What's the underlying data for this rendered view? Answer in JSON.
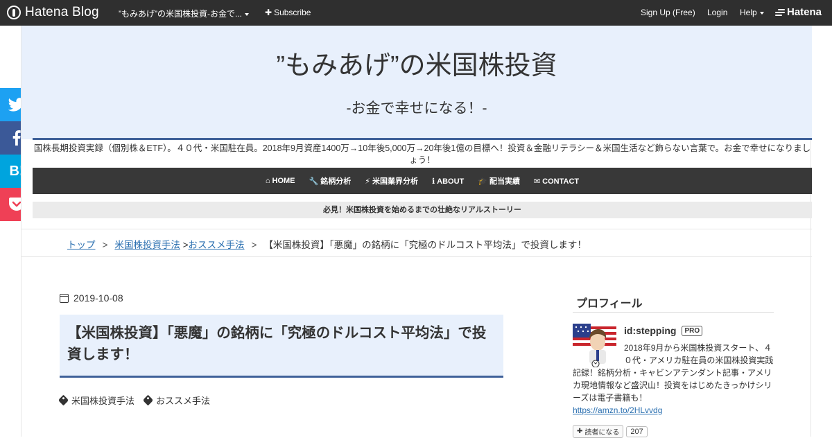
{
  "topbar": {
    "logo_text": "Hatena Blog",
    "blog_name": "”もみあげ”の米国株投資-お金で...",
    "subscribe": "Subscribe",
    "signup": "Sign Up (Free)",
    "login": "Login",
    "help": "Help",
    "hatena": "Hatena"
  },
  "header": {
    "title": "”もみあげ”の米国株投資",
    "subtitle": "-お金で幸せになる！-",
    "description": "国株長期投資実録（個別株＆ETF）。４０代・米国駐在員。2018年9月資産1400万→10年後5,000万→20年後1億の目標へ！投資＆金融リテラシー＆米国生活など飾らない言葉で。お金で幸せになりましょう！"
  },
  "nav": {
    "items": [
      {
        "icon": "home-icon",
        "glyph": "⌂",
        "label": "HOME"
      },
      {
        "icon": "wrench-icon",
        "glyph": "🔧",
        "label": "銘柄分析"
      },
      {
        "icon": "bolt-icon",
        "glyph": "⚡",
        "label": "米国業界分析"
      },
      {
        "icon": "info-icon",
        "glyph": "ℹ",
        "label": "ABOUT"
      },
      {
        "icon": "graduation-cap-icon",
        "glyph": "🎓",
        "label": "配当実績"
      },
      {
        "icon": "envelope-icon",
        "glyph": "✉",
        "label": "CONTACT"
      }
    ]
  },
  "notice": "必見！米国株投資を始めるまでの壮絶なリアルストーリー",
  "breadcrumb": {
    "items": [
      "トップ",
      "米国株投資手法",
      "おススメ手法"
    ],
    "current": "【米国株投資】「悪魔」の銘柄に「究極のドルコスト平均法」で投資します！",
    "separator": ">"
  },
  "article": {
    "date": "2019-10-08",
    "title": "【米国株投資】「悪魔」の銘柄に「究極のドルコスト平均法」で投資します！",
    "tags": [
      "米国株投資手法",
      "おススメ手法"
    ]
  },
  "sidebar": {
    "title": "プロフィール",
    "user_id": "id:stepping",
    "pro_badge": "PRO",
    "bio": "2018年9月から米国株投資スタート、４０代・アメリカ駐在員の米国株投資実践記録！銘柄分析・キャビンアテンダント記事・アメリカ現地情報など盛沢山！投資をはじめたきっかけシリーズは電子書籍も！",
    "link": "https://amzn.to/2HLvvdg",
    "reader_button": "読者になる",
    "reader_count": "207"
  },
  "share": {
    "twitter": "twitter-icon",
    "facebook": "facebook-icon",
    "hatebu_label": "B!",
    "pocket": "pocket-icon"
  },
  "colors": {
    "topbar_bg": "#2f2f2f",
    "header_bg": "#e8f0fc",
    "accent_line": "#3f6199",
    "nav_bg": "#383838",
    "link": "#2a6fb0",
    "twitter": "#1da1f2",
    "facebook": "#3b5998",
    "hatebu": "#00a4de",
    "pocket": "#ef4056"
  }
}
